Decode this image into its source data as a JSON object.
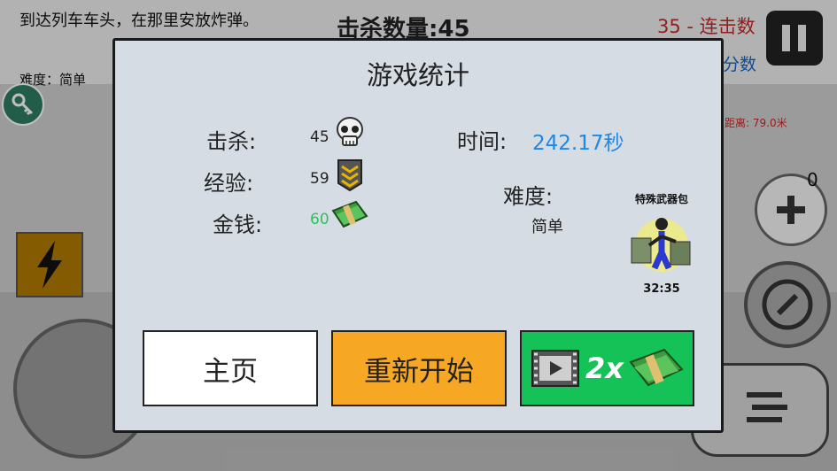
{
  "hud": {
    "mission_text": "到达列车车头，在那里安放炸弹。",
    "difficulty_text": "难度：简单",
    "kills_text": "击杀数量:45",
    "combo_text": "35 - 连击数",
    "score_label": "分数",
    "distance_label": "距离:",
    "distance_value": "79.0米",
    "plus_count": "0"
  },
  "stats": {
    "title": "游戏统计",
    "kills_label": "击杀:",
    "kills_value": "45",
    "xp_label": "经验:",
    "xp_value": "59",
    "money_label": "金钱:",
    "money_value": "60",
    "time_label": "时间:",
    "time_value": "242.17秒",
    "difficulty_label": "难度:",
    "difficulty_value": "简单",
    "pack_title": "特殊武器包",
    "pack_timer": "32:35"
  },
  "buttons": {
    "home": "主页",
    "restart": "重新开始",
    "double": "2x"
  },
  "colors": {
    "time_blue": "#1e88e5",
    "money_green": "#2ec05a",
    "restart_orange": "#f6a723",
    "double_green": "#14c257",
    "combo_red": "#c62828"
  }
}
